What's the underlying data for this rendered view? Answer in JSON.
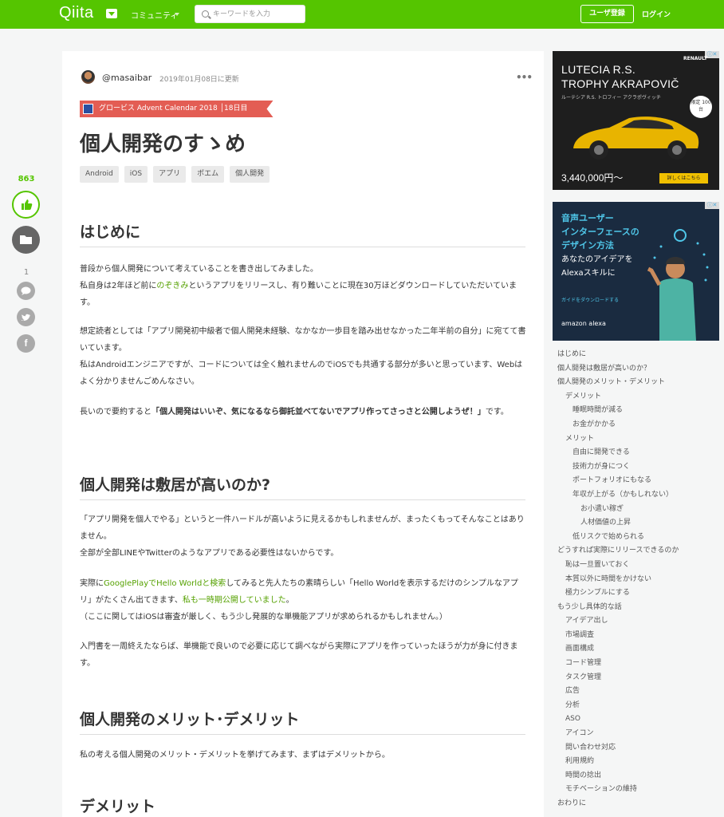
{
  "header": {
    "logo": "Qiita",
    "community": "コミュニティ",
    "search_placeholder": "キーワードを入力",
    "signup": "ユーザ登録",
    "login": "ログイン"
  },
  "sidebar_left": {
    "likes": "863",
    "comments": "1"
  },
  "article": {
    "author": "@masaibar",
    "updated": "2019年01月08日に更新",
    "advent": "グロービス Advent Calendar 2018 │18日目",
    "title": "個人開発のすゝめ",
    "tags": [
      "Android",
      "iOS",
      "アプリ",
      "ポエム",
      "個人開発"
    ],
    "h_intro": "はじめに",
    "intro_p1_a": "普段から個人開発について考えていることを書き出してみました。",
    "intro_p1_b": "私自身は2年ほど前に",
    "intro_p1_link": "のぞきみ",
    "intro_p1_c": "というアプリをリリースし、有り難いことに現在30万ほどダウンロードしていただいています。",
    "intro_p2_a": "想定読者としては「アプリ開発初中級者で個人開発未経験、なかなか一歩目を踏み出せなかった二年半前の自分」に宛てて書いています。",
    "intro_p2_b": "私はAndroidエンジニアですが、コードについては全く触れませんのでiOSでも共通する部分が多いと思っています、Webはよく分かりませんごめんなさい。",
    "intro_p3_a": "長いので要約すると",
    "intro_p3_bold": "「個人開発はいいぞ、気になるなら御託並べてないでアプリ作ってさっさと公開しようぜ！」",
    "intro_p3_c": "です。",
    "h_hurdle": "個人開発は敷居が高いのか?",
    "hurdle_p1_a": "「アプリ開発を個人でやる」というと一件ハードルが高いように見えるかもしれませんが、まったくもってそんなことはありません。",
    "hurdle_p1_b": "全部が全部LINEやTwitterのようなアプリである必要性はないからです。",
    "hurdle_p2_a": "実際に",
    "hurdle_p2_link1": "GooglePlayでHello Worldと検索",
    "hurdle_p2_b": "してみると先人たちの素晴らしい「Hello Worldを表示するだけのシンプルなアプリ」がたくさん出てきます、",
    "hurdle_p2_link2": "私も一時期公開していました",
    "hurdle_p2_c": "。",
    "hurdle_p2_d": "（ここに関してはiOSは審査が厳しく、もう少し発展的な単機能アプリが求められるかもしれません。）",
    "hurdle_p3": "入門書を一周終えたならば、単機能で良いので必要に応じて調べながら実際にアプリを作っていったほうが力が身に付きます。",
    "h_merit": "個人開発のメリット･デメリット",
    "merit_p1": "私の考える個人開発のメリット・デメリットを挙げてみます、まずはデメリットから。",
    "h_demerit": "デメリット"
  },
  "ads": {
    "ad1_title_1": "LUTECIA R.S.",
    "ad1_title_2": "TROPHY AKRAPOVIČ",
    "ad1_sub": "ルーテシア R.S. トロフィー アクラポヴィッチ",
    "ad1_price": "3,440,000円～",
    "ad1_button": "詳しくはこちら",
    "ad1_badge": "限定 100台",
    "ad1_brand": "RENAULT",
    "ad2_title_1": "音声ユーザー",
    "ad2_title_2": "インターフェースの",
    "ad2_title_3": "デザイン方法",
    "ad2_sub_1": "あなたのアイデアを",
    "ad2_sub_2": "Alexaスキルに",
    "ad2_link": "ガイドをダウンロードする",
    "ad2_brand": "amazon alexa"
  },
  "toc": [
    {
      "level": 1,
      "text": "はじめに"
    },
    {
      "level": 1,
      "text": "個人開発は敷居が高いのか？"
    },
    {
      "level": 1,
      "text": "個人開発のメリット・デメリット"
    },
    {
      "level": 2,
      "text": "デメリット"
    },
    {
      "level": 3,
      "text": "睡眠時間が減る"
    },
    {
      "level": 3,
      "text": "お金がかかる"
    },
    {
      "level": 2,
      "text": "メリット"
    },
    {
      "level": 3,
      "text": "自由に開発できる"
    },
    {
      "level": 3,
      "text": "技術力が身につく"
    },
    {
      "level": 3,
      "text": "ポートフォリオにもなる"
    },
    {
      "level": 3,
      "text": "年収が上がる（かもしれない）"
    },
    {
      "level": 4,
      "text": "お小遣い稼ぎ"
    },
    {
      "level": 4,
      "text": "人材価値の上昇"
    },
    {
      "level": 3,
      "text": "低リスクで始められる"
    },
    {
      "level": 1,
      "text": "どうすれば実際にリリースできるのか"
    },
    {
      "level": 2,
      "text": "恥は一旦置いておく"
    },
    {
      "level": 2,
      "text": "本質以外に時間をかけない"
    },
    {
      "level": 2,
      "text": "極力シンプルにする"
    },
    {
      "level": 1,
      "text": "もう少し具体的な話"
    },
    {
      "level": 2,
      "text": "アイデア出し"
    },
    {
      "level": 2,
      "text": "市場調査"
    },
    {
      "level": 2,
      "text": "画面構成"
    },
    {
      "level": 2,
      "text": "コード管理"
    },
    {
      "level": 2,
      "text": "タスク管理"
    },
    {
      "level": 2,
      "text": "広告"
    },
    {
      "level": 2,
      "text": "分析"
    },
    {
      "level": 2,
      "text": "ASO"
    },
    {
      "level": 2,
      "text": "アイコン"
    },
    {
      "level": 2,
      "text": "問い合わせ対応"
    },
    {
      "level": 2,
      "text": "利用規約"
    },
    {
      "level": 2,
      "text": "時間の捻出"
    },
    {
      "level": 2,
      "text": "モチベーションの維持"
    },
    {
      "level": 1,
      "text": "おわりに"
    }
  ]
}
